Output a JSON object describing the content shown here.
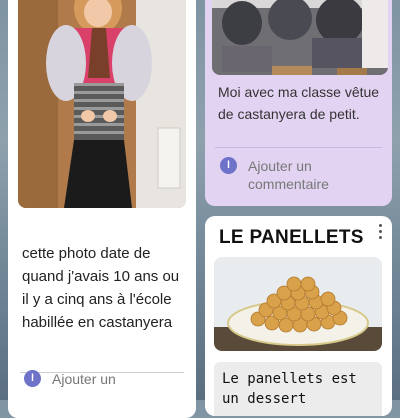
{
  "left_card": {
    "caption": "cette photo date de quand j'avais 10 ans ou il y a cinq ans à l'école habillée en castanyera",
    "comment_avatar": "l",
    "comment_prompt": "Ajouter un"
  },
  "right_top_card": {
    "caption": "Moi avec ma classe vêtue de castanyera de petit.",
    "comment_avatar": "l",
    "comment_prompt": "Ajouter un commentaire"
  },
  "right_bottom_card": {
    "title": "LE PANELLETS",
    "body_excerpt": "Le panellets est un dessert"
  },
  "colors": {
    "background": "#7f94a3",
    "card_white": "#ffffff",
    "card_lavender": "#e3d3f2",
    "avatar": "#6e72c8"
  },
  "icons": [
    "avatar-icon",
    "more-options-icon"
  ]
}
